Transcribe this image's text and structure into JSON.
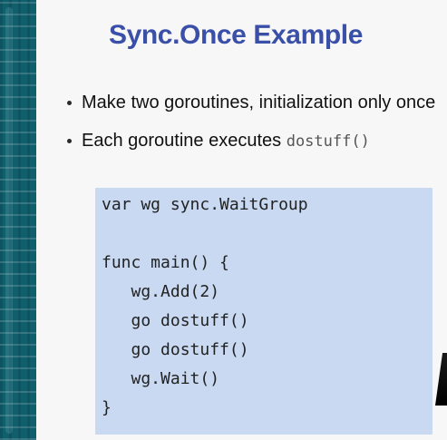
{
  "slide": {
    "title": "Sync.Once Example",
    "bullets": [
      {
        "text": "Make two goroutines, initialization only once"
      },
      {
        "text": "Each goroutine executes ",
        "code": "dostuff()"
      }
    ],
    "code_lines": [
      "var wg sync.WaitGroup",
      "",
      "func main() {",
      "   wg.Add(2)",
      "   go dostuff()",
      "   go dostuff()",
      "   wg.Wait()",
      "}"
    ]
  },
  "colors": {
    "sidebar": "#0f5f6d",
    "title": "#3a4fa8",
    "code_bg": "#c8d9f1"
  }
}
